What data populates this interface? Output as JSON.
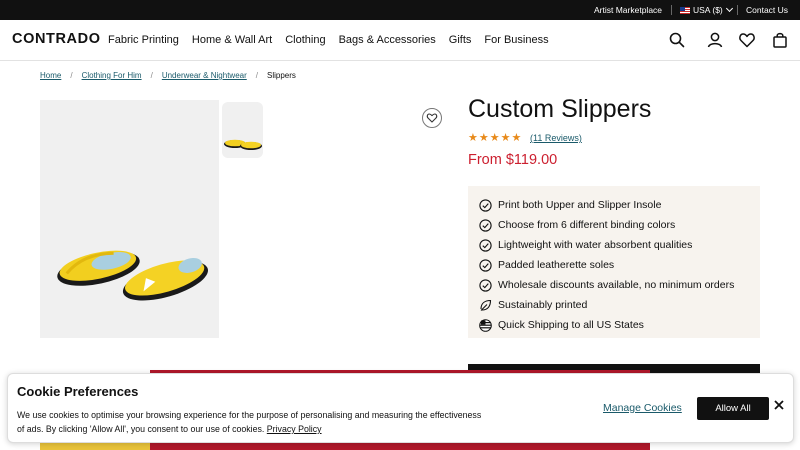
{
  "topbar": {
    "artist_marketplace": "Artist Marketplace",
    "currency": "USA ($)",
    "contact": "Contact Us"
  },
  "header": {
    "logo": "CONTRADO",
    "nav": [
      "Fabric Printing",
      "Home & Wall Art",
      "Clothing",
      "Bags & Accessories",
      "Gifts",
      "For Business"
    ],
    "icons": [
      "search-icon",
      "account-icon",
      "wishlist-icon",
      "cart-icon"
    ]
  },
  "breadcrumb": {
    "items": [
      "Home",
      "Clothing For Him",
      "Underwear & Nightwear",
      "Slippers"
    ]
  },
  "product": {
    "title": "Custom Slippers",
    "stars": "★★★★★",
    "rating": 5,
    "reviews": "(11 Reviews)",
    "price": "From $119.00",
    "features": [
      {
        "icon": "check-circle-icon",
        "text": "Print both Upper and Slipper Insole"
      },
      {
        "icon": "check-circle-icon",
        "text": "Choose from 6 different binding colors"
      },
      {
        "icon": "check-circle-icon",
        "text": "Lightweight with water absorbent qualities"
      },
      {
        "icon": "check-circle-icon",
        "text": "Padded leatherette soles"
      },
      {
        "icon": "check-circle-icon",
        "text": "Wholesale discounts available, no minimum orders"
      },
      {
        "icon": "leaf-icon",
        "text": "Sustainably printed"
      },
      {
        "icon": "us-globe-icon",
        "text": "Quick Shipping to all US States"
      }
    ]
  },
  "cookie": {
    "title": "Cookie Preferences",
    "body": "We use cookies to optimise your browsing experience for the purpose of personalising and measuring the effectiveness of ads. By clicking 'Allow All', you consent to our use of cookies. ",
    "policy_link": "Privacy Policy",
    "manage": "Manage Cookies",
    "allow": "Allow All"
  },
  "colors": {
    "accent_red": "#cc1f2f",
    "link_teal": "#1a5a6a",
    "star_orange": "#e88a1a",
    "feature_bg": "#f7f3ee",
    "slipper_yellow": "#f2cf1f"
  }
}
